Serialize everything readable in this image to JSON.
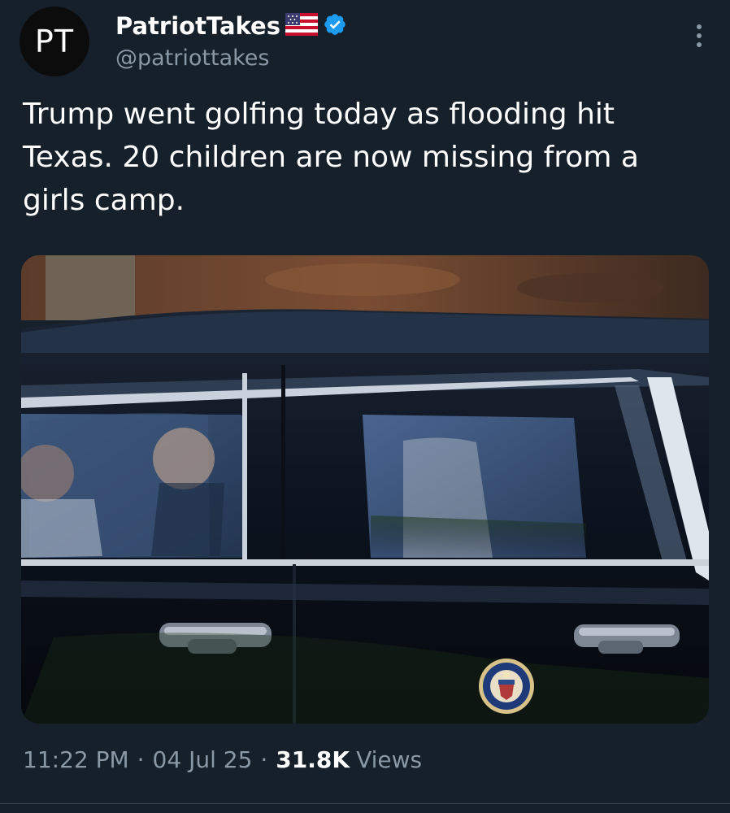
{
  "author": {
    "avatar_text": "PT",
    "display_name": "PatriotTakes",
    "handle": "@patriottakes",
    "flag_icon": "us-flag-icon",
    "verified_icon": "verified-badge-icon",
    "verified_color": "#1d9bf0"
  },
  "tweet": {
    "text": "Trump went golfing today as flooding hit Texas. 20 children are now missing from a girls camp."
  },
  "media": {
    "description_icon": "photo",
    "seal_icon": "presidential-seal-icon"
  },
  "meta": {
    "time": "11:22 PM",
    "separator": "·",
    "date": "04 Jul 25",
    "views_count": "31.8K",
    "views_label": "Views"
  },
  "colors": {
    "background": "#15202b",
    "text_primary": "#ffffff",
    "text_secondary": "#8b98a5"
  }
}
